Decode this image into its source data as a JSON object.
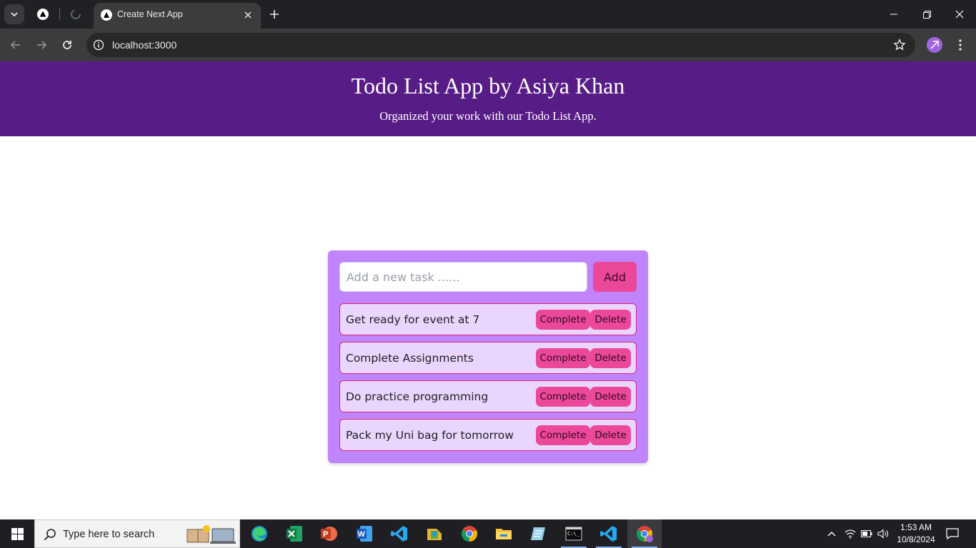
{
  "browser": {
    "tab_title": "Create Next App",
    "url": "localhost:3000"
  },
  "header": {
    "title": "Todo List App by Asiya Khan",
    "subtitle": "Organized your work with our Todo List App."
  },
  "form": {
    "input_value": "",
    "input_placeholder": "Add a new task ......",
    "add_label": "Add"
  },
  "todos": [
    {
      "text": "Get ready for event at 7",
      "complete_label": "Complete",
      "delete_label": "Delete"
    },
    {
      "text": "Complete Assignments",
      "complete_label": "Complete",
      "delete_label": "Delete"
    },
    {
      "text": "Do practice programming",
      "complete_label": "Complete",
      "delete_label": "Delete"
    },
    {
      "text": "Pack my Uni bag for tomorrow",
      "complete_label": "Complete",
      "delete_label": "Delete"
    }
  ],
  "colors": {
    "header_bg": "#581c87",
    "card_bg": "#c084fc",
    "item_bg": "#ead5fe",
    "button_bg": "#ec4899",
    "item_border": "#db2777"
  },
  "taskbar": {
    "search_placeholder": "Type here to search",
    "apps": [
      "edge-icon",
      "excel-icon",
      "powerpoint-icon",
      "word-icon",
      "vscode-icon",
      "photos-icon",
      "chrome-icon",
      "file-explorer-icon",
      "notes-icon",
      "terminal-icon",
      "vscode-icon",
      "chrome-profile-icon"
    ],
    "time": "1:53 AM",
    "date": "10/8/2024"
  }
}
